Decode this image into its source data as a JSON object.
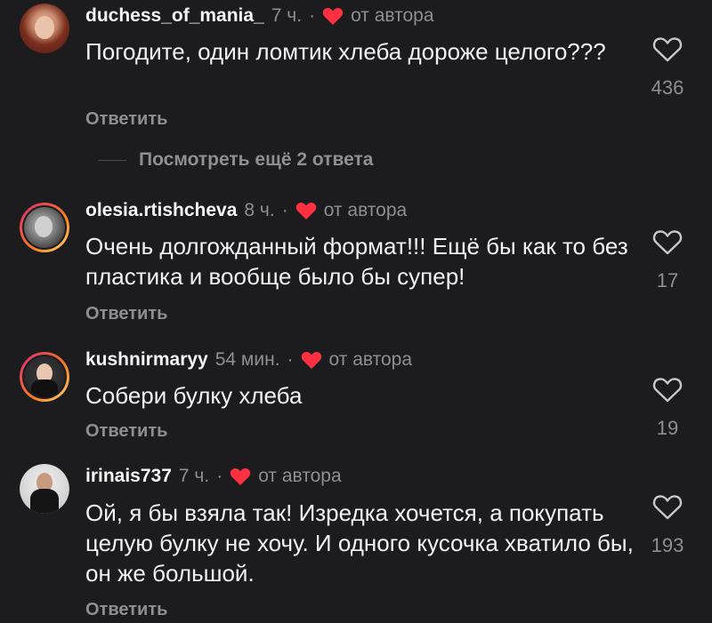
{
  "comments": [
    {
      "username": "duchess_of_mania_",
      "time": "7 ч.",
      "author_label": "от автора",
      "text": "Погодите, один ломтик хлеба дороже целого???",
      "reply_label": "Ответить",
      "likes": "436"
    },
    {
      "username": "olesia.rtishcheva",
      "time": "8 ч.",
      "author_label": "от автора",
      "text": "Очень долгожданный формат!!! Ещё бы как то без пластика и вообще было бы супер!",
      "reply_label": "Ответить",
      "likes": "17"
    },
    {
      "username": "kushnirmaryy",
      "time": "54 мин.",
      "author_label": "от автора",
      "text": "Собери булку хлеба",
      "reply_label": "Ответить",
      "likes": "19"
    },
    {
      "username": "irinais737",
      "time": "7 ч.",
      "author_label": "от автора",
      "text": "Ой, я бы взяла так! Изредка хочется, а покупать целую булку не хочу. И одного кусочка хватило бы, он же большой.",
      "reply_label": "Ответить",
      "likes": "193"
    }
  ],
  "view_more": {
    "label": "Посмотреть ещё 2 ответа"
  },
  "colors": {
    "background": "#1c1c1e",
    "heart_red": "#ff3040",
    "muted": "#8e8e93"
  },
  "icons": {
    "like": "heart-outline-icon",
    "author_liked": "heart-filled-icon"
  }
}
